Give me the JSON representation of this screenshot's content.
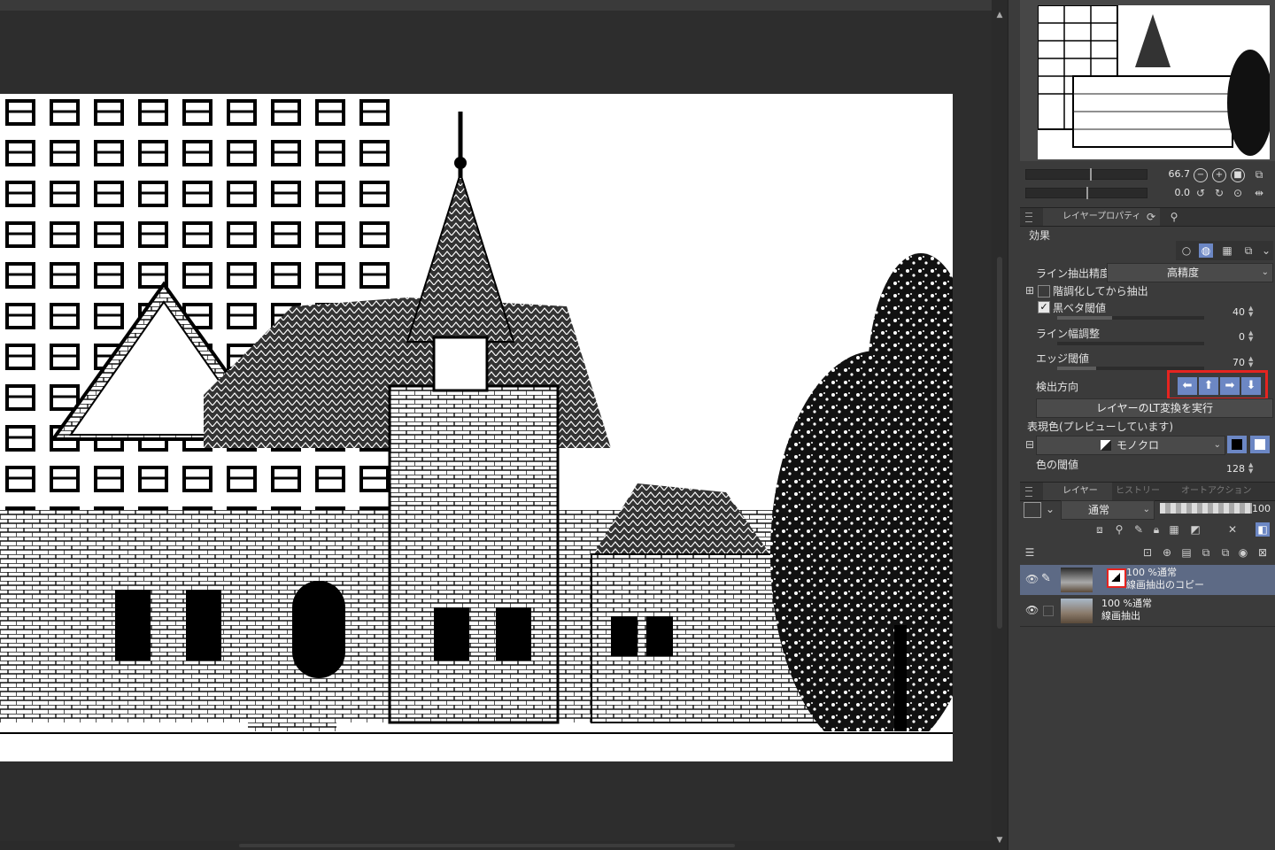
{
  "canvas": {
    "description_free": ""
  },
  "navigator": {
    "zoom_value": "66.7",
    "rotate_value": "0.0"
  },
  "property_tabs": {
    "active": "レイヤープロパティ"
  },
  "effect": {
    "section_title": "効果",
    "line_precision_label": "ライン抽出精度",
    "line_precision_value": "高精度",
    "posterize_label": "階調化してから抽出",
    "black_threshold_label": "黒ベタ閾値",
    "black_threshold_value": "40",
    "line_width_label": "ライン幅調整",
    "line_width_value": "0",
    "edge_threshold_label": "エッジ閾値",
    "edge_threshold_value": "70",
    "detect_direction_label": "検出方向",
    "execute_button": "レイヤーのLT変換を実行",
    "expression_color_label": "表現色(プレビューしています)",
    "expression_color_value": "モノクロ",
    "color_threshold_label": "色の閾値",
    "color_threshold_value": "128",
    "posterize_checked": false,
    "black_threshold_checked": true
  },
  "layer_tabs": {
    "active": "レイヤー",
    "history": "ヒストリー",
    "auto_action": "オートアクション"
  },
  "layers_panel": {
    "blend_mode": "通常",
    "opacity": "100",
    "layers": [
      {
        "line1": "100 %通常",
        "line2": "線画抽出のコピー",
        "selected": true
      },
      {
        "line1": "100 %通常",
        "line2": "線画抽出",
        "selected": false
      }
    ]
  },
  "icons": [
    "eye-icon",
    "pen-icon",
    "arrow-left-icon",
    "arrow-up-icon",
    "arrow-right-icon",
    "arrow-down-icon",
    "zoom-out-icon",
    "zoom-in-icon",
    "rotate-left-icon",
    "rotate-right-icon",
    "flip-icon",
    "lock-icon",
    "layers-icon"
  ],
  "colors": {
    "accent_blue": "#6c87c4",
    "highlight_red": "#e52420",
    "selected_layer": "#5d6a85",
    "panel": "#3b3b3b"
  }
}
